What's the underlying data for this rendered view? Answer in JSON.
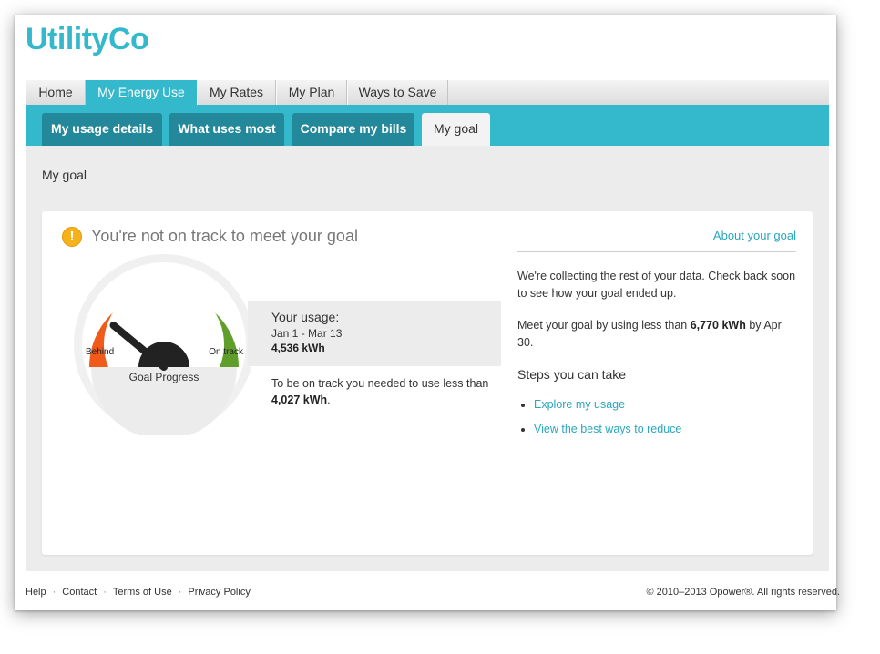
{
  "app": {
    "logo": "UtilityCo"
  },
  "main_nav": {
    "tabs": [
      {
        "label": "Home"
      },
      {
        "label": "My Energy Use",
        "active": true
      },
      {
        "label": "My Rates"
      },
      {
        "label": "My Plan"
      },
      {
        "label": "Ways to Save"
      }
    ]
  },
  "sub_nav": {
    "tabs": [
      {
        "label": "My usage details"
      },
      {
        "label": "What uses most"
      },
      {
        "label": "Compare my bills"
      },
      {
        "label": "My goal",
        "active": true
      }
    ]
  },
  "page": {
    "title": "My goal"
  },
  "goal": {
    "status_icon": "warning-icon",
    "status_title": "You're not on track to meet your goal",
    "about_link": "About your goal",
    "gauge": {
      "label_behind": "Behind",
      "label_ontrack": "On track",
      "caption": "Goal Progress",
      "needle_fraction": 0.22,
      "colors": [
        "#f05a1a",
        "#fdb515",
        "#94c93d",
        "#5f9e2a"
      ]
    },
    "usage": {
      "label": "Your usage:",
      "range": "Jan 1 - Mar 13",
      "value": "4,536 kWh"
    },
    "ontrack_text": "To be on track you needed to use less than",
    "ontrack_value": "4,027 kWh",
    "ontrack_suffix": ".",
    "collecting_text": "We're collecting the rest of your data. Check back soon to see how your goal ended up.",
    "meet_prefix": "Meet your goal by using less than",
    "meet_value": "6,770 kWh",
    "meet_suffix": "by Apr 30.",
    "steps_title": "Steps you can take",
    "steps": [
      {
        "label": "Explore my usage"
      },
      {
        "label": "View the best ways to reduce"
      }
    ]
  },
  "footer": {
    "links": [
      "Help",
      "Contact",
      "Terms of Use",
      "Privacy Policy"
    ],
    "copyright": "© 2010–2013 Opower®. All rights reserved."
  }
}
